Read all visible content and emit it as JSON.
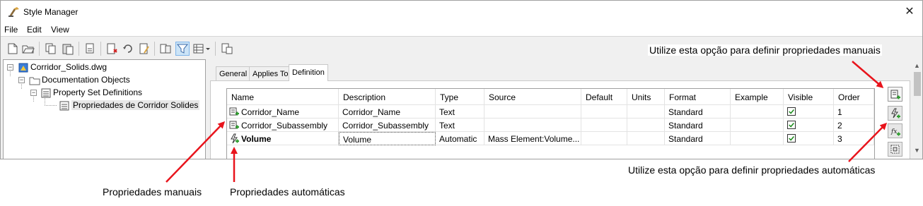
{
  "window": {
    "title": "Style Manager",
    "close_glyph": "✕"
  },
  "menu": [
    "File",
    "Edit",
    "View"
  ],
  "tree": {
    "root": "Corridor_Solids.dwg",
    "child1": "Documentation Objects",
    "child2": "Property Set Definitions",
    "child3": "Propriedades de Corridor Solides"
  },
  "tabs": [
    "General",
    "Applies To",
    "Definition"
  ],
  "grid": {
    "columns": [
      "Name",
      "Description",
      "Type",
      "Source",
      "Default",
      "Units",
      "Format",
      "Example",
      "Visible",
      "Order"
    ],
    "rows": [
      {
        "icon": "manual-property-icon",
        "name": "Corridor_Name",
        "description": "Corridor_Name",
        "type": "Text",
        "source": "",
        "default": "",
        "units": "",
        "format": "Standard",
        "example": "",
        "visible": true,
        "order": "1",
        "bold": false
      },
      {
        "icon": "manual-property-icon",
        "name": "Corridor_Subassembly",
        "description": "Corridor_Subassembly",
        "type": "Text",
        "source": "",
        "default": "",
        "units": "",
        "format": "Standard",
        "example": "",
        "visible": true,
        "order": "2",
        "bold": false
      },
      {
        "icon": "automatic-property-icon",
        "name": "Volume",
        "description": "Volume",
        "type": "Automatic",
        "source": "Mass Element:Volume...",
        "default": "",
        "units": "",
        "format": "Standard",
        "example": "",
        "visible": true,
        "order": "3",
        "bold": true
      }
    ]
  },
  "annotations": {
    "top_right": "Utilize esta opção para definir propriedades manuais",
    "bottom_right": "Utilize esta opção para definir propriedades automáticas",
    "manual": "Propriedades manuais",
    "automatic": "Propriedades automáticas"
  },
  "colors": {
    "arrow": "#e8141c",
    "check": "#1a8a1a",
    "accent_green": "#2f9e2f"
  }
}
